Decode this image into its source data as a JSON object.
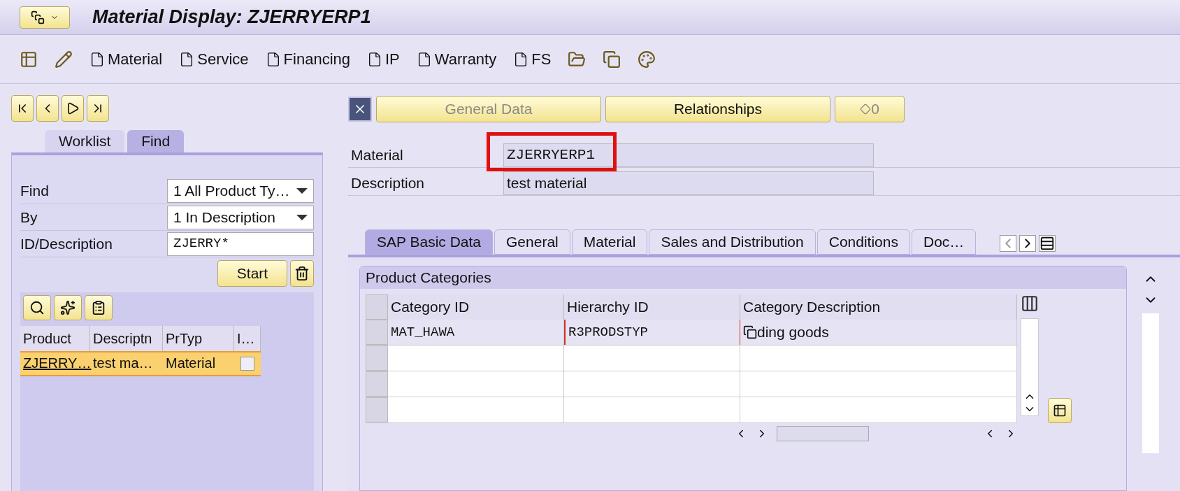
{
  "window": {
    "title": "Material Display: ZJERRYERP1"
  },
  "toolbar": [
    {
      "kind": "icon"
    },
    {
      "kind": "icon"
    },
    {
      "kind": "doc",
      "label": "Material"
    },
    {
      "kind": "doc",
      "label": "Service"
    },
    {
      "kind": "doc",
      "label": "Financing"
    },
    {
      "kind": "doc",
      "label": "IP"
    },
    {
      "kind": "doc",
      "label": "Warranty"
    },
    {
      "kind": "doc",
      "label": "FS"
    },
    {
      "kind": "icon"
    },
    {
      "kind": "icon"
    },
    {
      "kind": "icon"
    }
  ],
  "left_tabs": [
    {
      "label": "Worklist",
      "selected": false
    },
    {
      "label": "Find",
      "selected": true
    }
  ],
  "find_form": [
    {
      "kind": "select",
      "label": "Find",
      "value": "1 All Product Ty…"
    },
    {
      "kind": "select",
      "label": "By",
      "value": "1 In Description"
    },
    {
      "kind": "input",
      "label": "ID/Description",
      "value": "ZJERRY*"
    }
  ],
  "start_button": "Start",
  "results": {
    "columns": [
      "Product",
      "Descriptn",
      "PrTyp",
      "I…"
    ],
    "rows": [
      {
        "selected": true,
        "product": "ZJERRY…",
        "description": "test ma…",
        "type": "Material",
        "checked": false
      }
    ]
  },
  "view_buttons": [
    {
      "label": "General Data",
      "disabled": true
    },
    {
      "label": "Relationships",
      "disabled": false
    }
  ],
  "counter": "0",
  "header_fields": [
    {
      "label": "Material",
      "value": "ZJERRYERP1",
      "highlighted": true
    },
    {
      "label": "Description",
      "value": "test material",
      "highlighted": false
    }
  ],
  "tabs": [
    {
      "label": "SAP Basic Data",
      "selected": true
    },
    {
      "label": "General",
      "selected": false
    },
    {
      "label": "Material",
      "selected": false
    },
    {
      "label": "Sales and Distribution",
      "selected": false
    },
    {
      "label": "Conditions",
      "selected": false
    },
    {
      "label": "Doc…",
      "selected": false
    }
  ],
  "group_title": "Product Categories",
  "categories": {
    "columns": [
      "Category ID",
      "Hierarchy ID",
      "Category Description"
    ],
    "rows": [
      {
        "cells": [
          {
            "text": "MAT_HAWA",
            "focused": false
          },
          {
            "text": "R3PRODSTYP",
            "focused": true
          },
          {
            "text": "ding goods",
            "focused": false
          }
        ]
      },
      {
        "cells": []
      },
      {
        "cells": []
      },
      {
        "cells": []
      }
    ]
  }
}
